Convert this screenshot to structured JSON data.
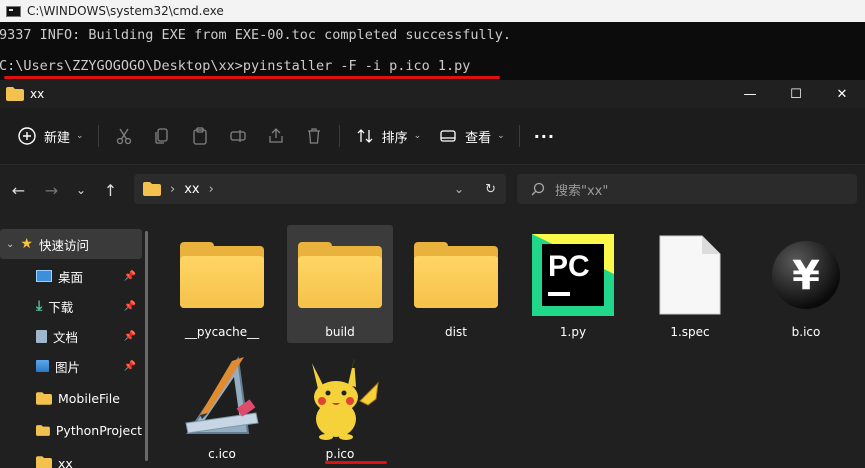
{
  "cmd": {
    "title": "C:\\WINDOWS\\system32\\cmd.exe",
    "lines": [
      "9337 INFO: Building EXE from EXE-00.toc completed successfully.",
      "C:\\Users\\ZZYGOGOGO\\Desktop\\xx>pyinstaller -F -i p.ico 1.py"
    ]
  },
  "explorer": {
    "title": "xx",
    "window_controls": {
      "minimize": "—",
      "maximize": "☐",
      "close": "✕"
    },
    "toolbar": {
      "new_label": "新建",
      "sort_label": "排序",
      "view_label": "查看",
      "more_label": "···"
    },
    "address": {
      "path": [
        "xx"
      ]
    },
    "search": {
      "placeholder": "搜索\"xx\""
    },
    "sidebar": {
      "items": [
        {
          "label": "快速访问",
          "icon": "star-icon",
          "expanded": true
        },
        {
          "label": "桌面",
          "icon": "desktop-icon",
          "pinned": true
        },
        {
          "label": "下载",
          "icon": "download-icon",
          "pinned": true
        },
        {
          "label": "文档",
          "icon": "document-icon",
          "pinned": true
        },
        {
          "label": "图片",
          "icon": "picture-icon",
          "pinned": true
        },
        {
          "label": "MobileFile",
          "icon": "folder-icon"
        },
        {
          "label": "PythonProject",
          "icon": "folder-icon"
        },
        {
          "label": "xx",
          "icon": "folder-icon"
        }
      ]
    },
    "files": [
      {
        "name": "__pycache__",
        "type": "folder"
      },
      {
        "name": "build",
        "type": "folder",
        "selected": true
      },
      {
        "name": "dist",
        "type": "folder"
      },
      {
        "name": "1.py",
        "type": "pycharm"
      },
      {
        "name": "1.spec",
        "type": "blank"
      },
      {
        "name": "b.ico",
        "type": "yen"
      },
      {
        "name": "c.ico",
        "type": "triangle-ruler"
      },
      {
        "name": "p.ico",
        "type": "pikachu"
      }
    ]
  },
  "colors": {
    "annotation_red": "#e01010",
    "folder_yellow": "#f5c24a",
    "accent_blue": "#4aa3ff"
  }
}
